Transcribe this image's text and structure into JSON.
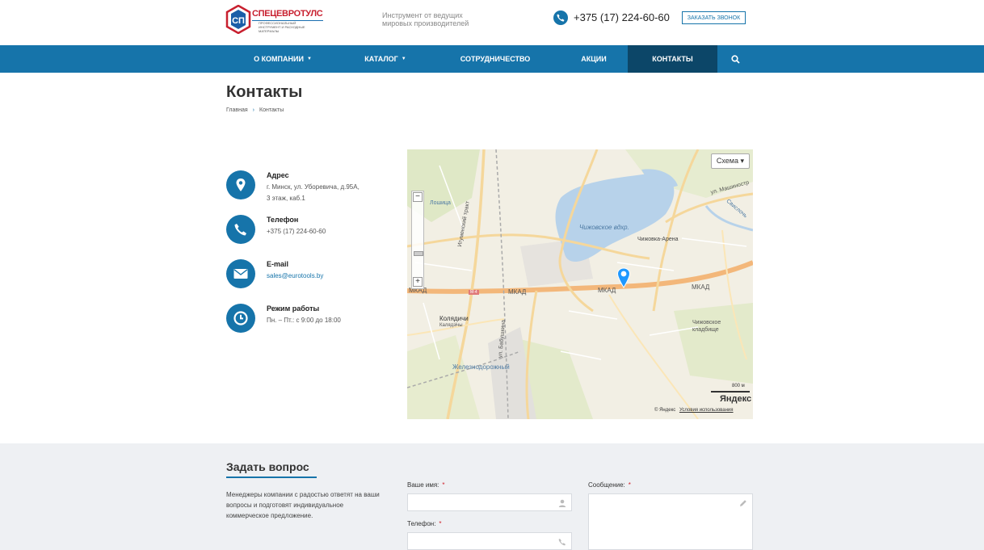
{
  "header": {
    "logo_text": "СПЕЦЕВРОТУЛС",
    "logo_sub": "ПРОФЕССИОНАЛЬНЫЙ ИНСТРУМЕНТ И РАСХОДНЫЕ МАТЕРИАЛЫ",
    "slogan_line1": "Инструмент от ведущих",
    "slogan_line2": "мировых производителей",
    "phone": "+375 (17) 224-60-60",
    "call_button": "ЗАКАЗАТЬ ЗВОНОК"
  },
  "nav": {
    "items": [
      {
        "label": "О КОМПАНИИ"
      },
      {
        "label": "КАТАЛОГ"
      },
      {
        "label": "СОТРУДНИЧЕСТВО"
      },
      {
        "label": "АКЦИИ"
      },
      {
        "label": "КОНТАКТЫ"
      }
    ]
  },
  "page": {
    "title": "Контакты",
    "breadcrumb_home": "Главная",
    "breadcrumb_current": "Контакты"
  },
  "contacts": {
    "address_label": "Адрес",
    "address_line1": "г. Минск, ул. Уборевича, д.95А,",
    "address_line2": "3 этаж, каб.1",
    "phone_label": "Телефон",
    "phone_value": "+375 (17) 224-60-60",
    "email_label": "E-mail",
    "email_value": "sales@eurotools.by",
    "hours_label": "Режим работы",
    "hours_value": "Пн. – Пт.: с 9:00 до 18:00"
  },
  "map": {
    "type_button": "Схема ▾",
    "labels": {
      "lake": "Чижовское вдхр.",
      "arena": "Чижовка-Арена",
      "mkad1": "МКАД",
      "mkad2": "МКАД",
      "mkad3": "МКАД",
      "mkad4": "МКАД",
      "kolyadichi": "Колядичи",
      "kolyadichi_by": "Калядзічы",
      "cemetery1": "Чижовское",
      "cemetery2": "кладбище",
      "rail": "Железнодорожный",
      "tract": "Игуменский тракт",
      "loshitsa": "Лошица",
      "mashinostro": "ул. Машиностр",
      "svisloch": "Свислочь",
      "babushkina": "ул. Бабушкина",
      "m4": "М-4"
    },
    "scale": "800 м",
    "brand": "Яндекс",
    "copyright": "© Яндекс",
    "terms": "Условия использования"
  },
  "ask": {
    "title": "Задать вопрос",
    "text": "Менеджеры компании с радостью ответят на ваши вопросы и подготовят индивидуальное коммерческое предложение.",
    "name_label": "Ваше имя:",
    "phone_label": "Телефон:",
    "message_label": "Сообщение:",
    "required_mark": "*"
  },
  "colors": {
    "primary": "#1674aa",
    "nav_active": "#0c4668",
    "brand_red": "#c8202f"
  }
}
